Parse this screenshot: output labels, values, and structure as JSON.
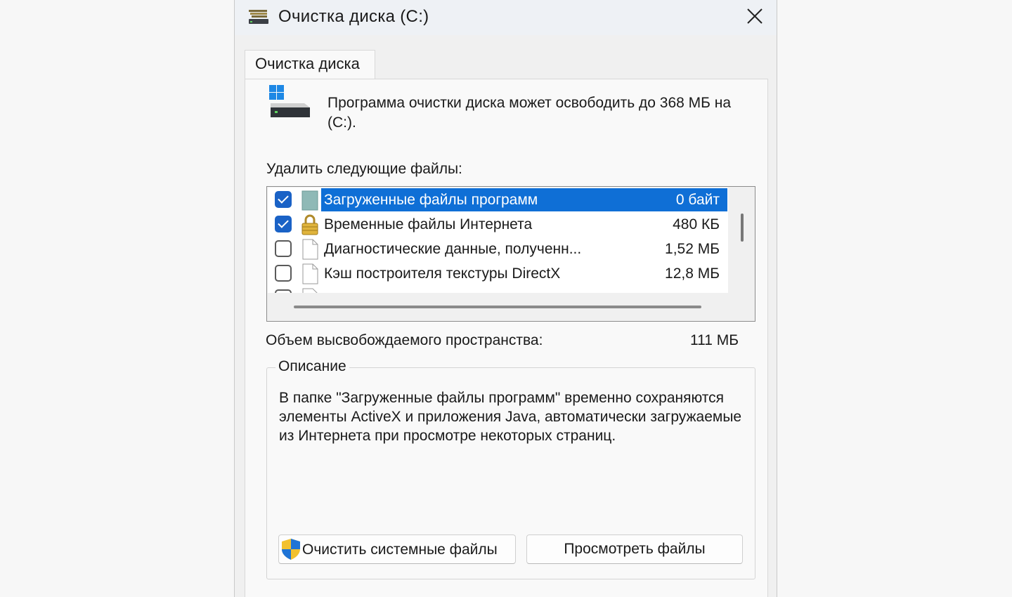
{
  "window": {
    "title": "Очистка диска  (C:)"
  },
  "tab": {
    "label": "Очистка диска"
  },
  "intro": {
    "text": "Программа очистки диска может освободить до 368 МБ на  (C:)."
  },
  "files_list": {
    "label": "Удалить следующие файлы:",
    "items": [
      {
        "label": "Загруженные файлы программ",
        "size": "0 байт",
        "checked": true,
        "selected": true,
        "icon": "folder-icon"
      },
      {
        "label": "Временные файлы Интернета",
        "size": "480 КБ",
        "checked": true,
        "selected": false,
        "icon": "lock-icon"
      },
      {
        "label": "Диагностические данные, полученн...",
        "size": "1,52 МБ",
        "checked": false,
        "selected": false,
        "icon": "file-icon"
      },
      {
        "label": "Кэш построителя текстуры DirectX",
        "size": "12,8 МБ",
        "checked": false,
        "selected": false,
        "icon": "file-icon"
      }
    ]
  },
  "space": {
    "label": "Объем высвобождаемого пространства:",
    "value": "111 МБ"
  },
  "description": {
    "title": "Описание",
    "text": "В папке \"Загруженные файлы программ\" временно сохраняются элементы ActiveX и приложения Java, автоматически загружаемые из Интернета при просмотре некоторых страниц."
  },
  "buttons": {
    "clean_system": "Очистить системные файлы",
    "view_files": "Просмотреть файлы"
  },
  "colors": {
    "selection": "#0f6fd6",
    "checkbox": "#1a62c6"
  }
}
